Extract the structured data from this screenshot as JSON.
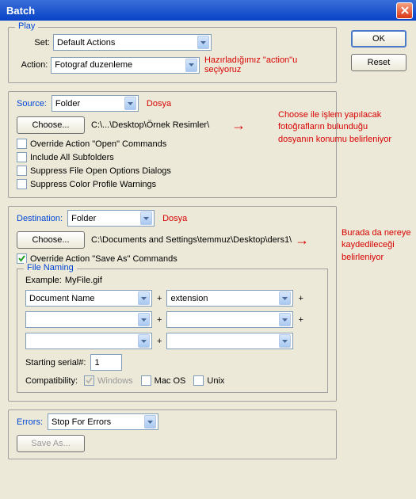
{
  "title": "Batch",
  "buttons": {
    "ok": "OK",
    "reset": "Reset"
  },
  "play": {
    "legend": "Play",
    "set_label": "Set:",
    "set_value": "Default Actions",
    "action_label": "Action:",
    "action_value": "Fotograf duzenleme",
    "note": "Hazırladığımız \"action\"u seçiyoruz"
  },
  "source": {
    "label": "Source:",
    "value": "Folder",
    "dosya": "Dosya",
    "choose": "Choose...",
    "path": "C:\\...\\Desktop\\Örnek Resimler\\",
    "cb_override": "Override Action \"Open\" Commands",
    "cb_subfolders": "Include All Subfolders",
    "cb_suppress_open": "Suppress File Open Options Dialogs",
    "cb_suppress_color": "Suppress Color Profile Warnings",
    "note": "Choose ile işlem yapılacak fotoğrafların bulunduğu dosyanın konumu belirleniyor"
  },
  "destination": {
    "label": "Destination:",
    "value": "Folder",
    "dosya": "Dosya",
    "choose": "Choose...",
    "path": "C:\\Documents and Settings\\temmuz\\Desktop\\ders1\\",
    "cb_override": "Override Action \"Save As\" Commands",
    "note": "Burada da nereye kaydedileceği belirleniyor"
  },
  "filenaming": {
    "legend": "File Naming",
    "example_label": "Example:",
    "example_value": "MyFile.gif",
    "parts": [
      "Document Name",
      "extension",
      "",
      "",
      "",
      ""
    ],
    "starting_label": "Starting serial#:",
    "starting_value": "1",
    "compat_label": "Compatibility:",
    "compat_win": "Windows",
    "compat_mac": "Mac OS",
    "compat_unix": "Unix"
  },
  "errors": {
    "label": "Errors:",
    "value": "Stop For Errors",
    "save_as": "Save As..."
  }
}
